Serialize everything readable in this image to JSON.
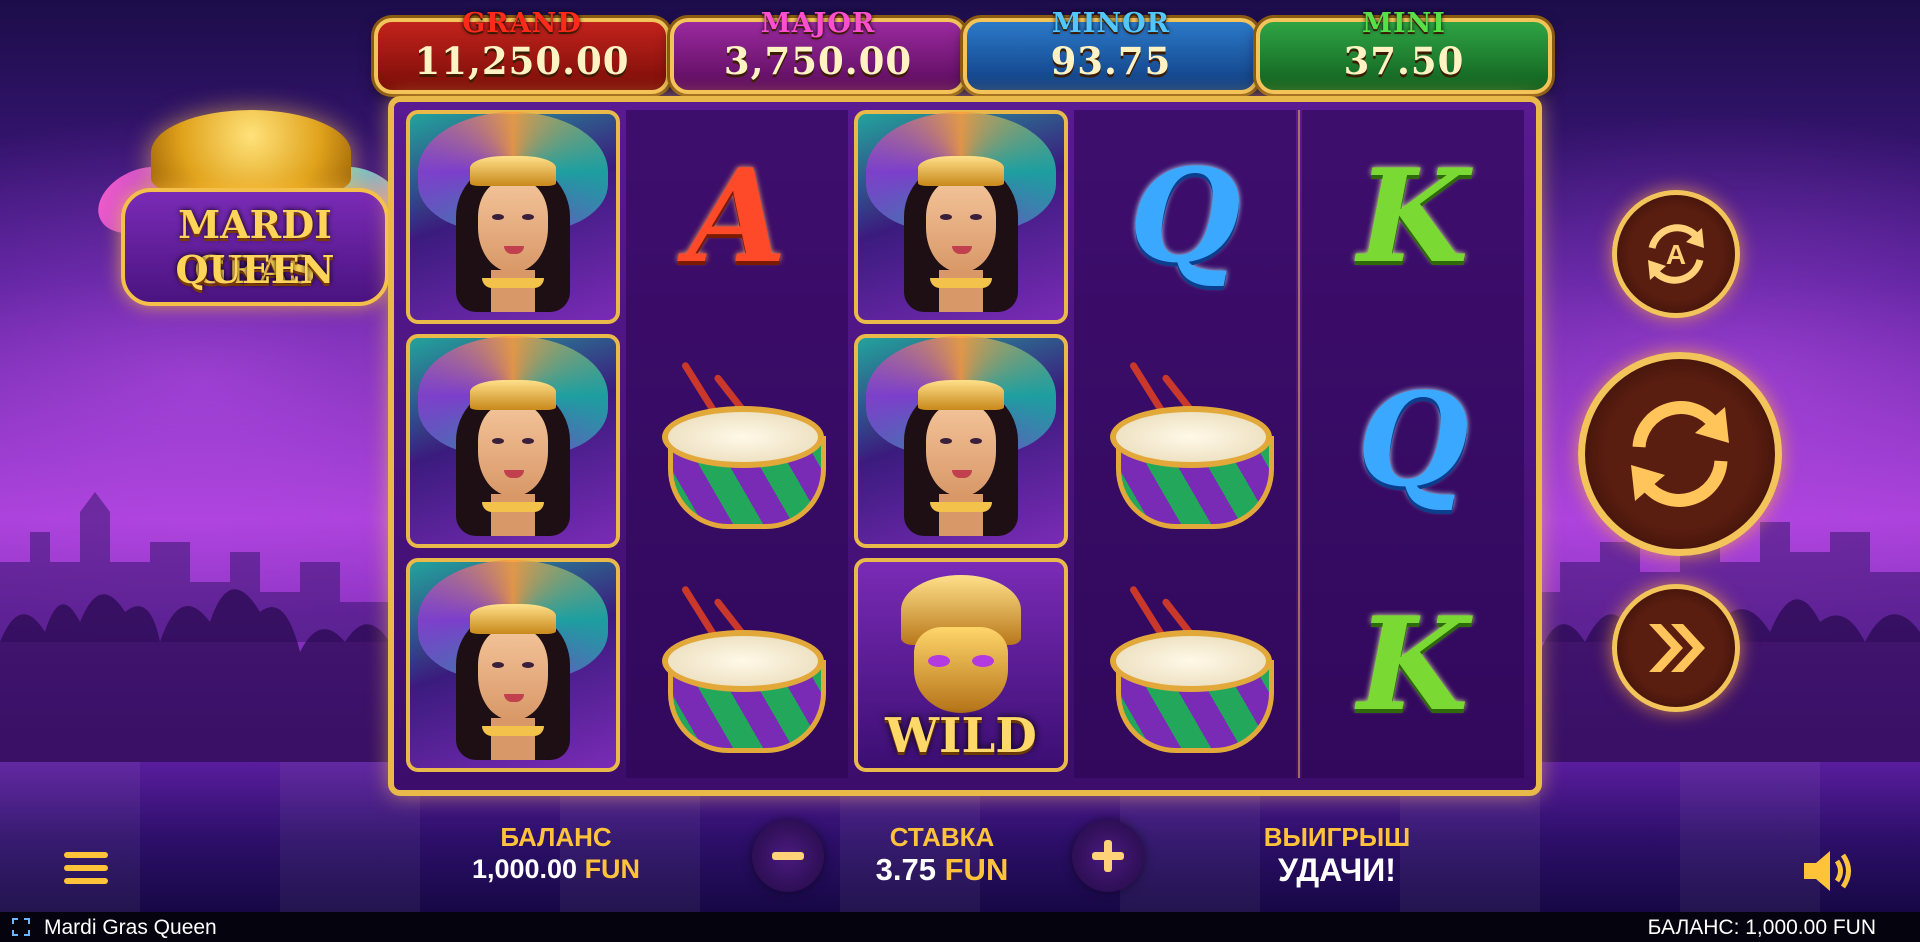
{
  "game": {
    "title": "Mardi Gras Queen",
    "logo_line1": "MARDI GRAS",
    "logo_line2": "QUEEN"
  },
  "jackpots": [
    {
      "name": "GRAND",
      "value": "11,250.00",
      "title_color": "#ff2a1a"
    },
    {
      "name": "MAJOR",
      "value": "3,750.00",
      "title_color": "#ff4fd0"
    },
    {
      "name": "MINOR",
      "value": "93.75",
      "title_color": "#52c7ff"
    },
    {
      "name": "MINI",
      "value": "37.50",
      "title_color": "#58e04a"
    }
  ],
  "reels": [
    [
      "queen",
      "queen",
      "queen"
    ],
    [
      "A",
      "drum",
      "drum"
    ],
    [
      "queen",
      "queen",
      "wild"
    ],
    [
      "Q",
      "drum",
      "drum"
    ],
    [
      "K",
      "Q",
      "K"
    ]
  ],
  "symbols": {
    "wild_label": "WILD",
    "A": "A",
    "Q": "Q",
    "K": "K"
  },
  "controls": {
    "autoplay_icon": "autoplay-icon",
    "autoplay_letter": "A",
    "spin_icon": "spin-icon",
    "turbo_icon": "fast-forward-icon",
    "menu_icon": "menu-icon",
    "sound_icon": "speaker-icon",
    "minus_label": "−",
    "plus_label": "+"
  },
  "hud": {
    "balance_label": "БАЛАНС",
    "balance_amount": "1,000.00",
    "balance_currency": "FUN",
    "bet_label": "СТАВКА",
    "bet_amount": "3.75",
    "bet_currency": "FUN",
    "win_label": "ВЫИГРЫШ",
    "win_message": "УДАЧИ!"
  },
  "statusbar": {
    "title": "Mardi Gras Queen",
    "balance_text": "БАЛАНС: 1,000.00 FUN"
  },
  "colors": {
    "gold": "#f3c45a",
    "accent": "#ffc33a",
    "frame": "#e9b949"
  }
}
